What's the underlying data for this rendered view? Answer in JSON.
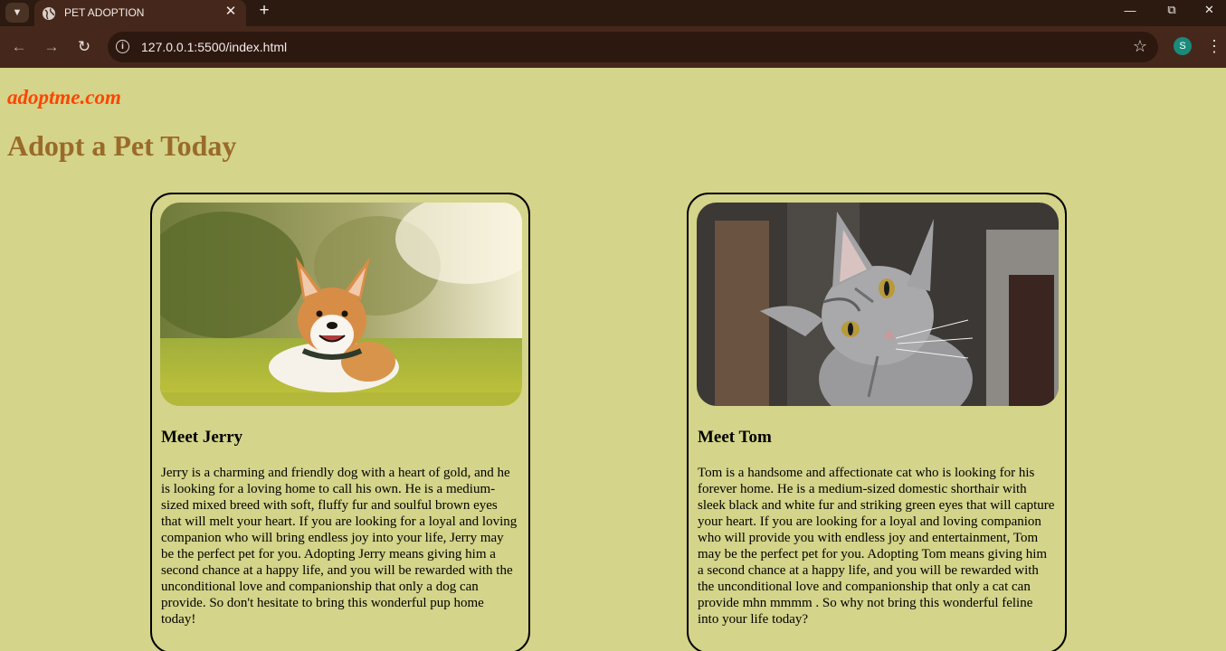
{
  "browser": {
    "tab_title": "PET ADOPTION",
    "url": "127.0.0.1:5500/index.html",
    "profile_initial": "S"
  },
  "site": {
    "logo": "adoptme.com",
    "headline": "Adopt a Pet Today"
  },
  "pets": [
    {
      "title": "Meet Jerry",
      "image_icon": "corgi-dog-photo",
      "description": "Jerry is a charming and friendly dog with a heart of gold, and he is looking for a loving home to call his own. He is a medium-sized mixed breed with soft, fluffy fur and soulful brown eyes that will melt your heart. If you are looking for a loyal and loving companion who will bring endless joy into your life, Jerry may be the perfect pet for you. Adopting Jerry means giving him a second chance at a happy life, and you will be rewarded with the unconditional love and companionship that only a dog can provide. So don't hesitate to bring this wonderful pup home today!"
    },
    {
      "title": "Meet Tom",
      "image_icon": "tabby-cat-photo",
      "description": "Tom is a handsome and affectionate cat who is looking for his forever home. He is a medium-sized domestic shorthair with sleek black and white fur and striking green eyes that will capture your heart. If you are looking for a loyal and loving companion who will provide you with endless joy and entertainment, Tom may be the perfect pet for you. Adopting Tom means giving him a second chance at a happy life, and you will be rewarded with the unconditional love and companionship that only a cat can provide mhn mmmm . So why not bring this wonderful feline into your life today?"
    }
  ],
  "colors": {
    "page_background": "#d4d48a",
    "logo": "#ff4500",
    "headline": "#9a6a2a",
    "browser_frame": "#45281b"
  }
}
